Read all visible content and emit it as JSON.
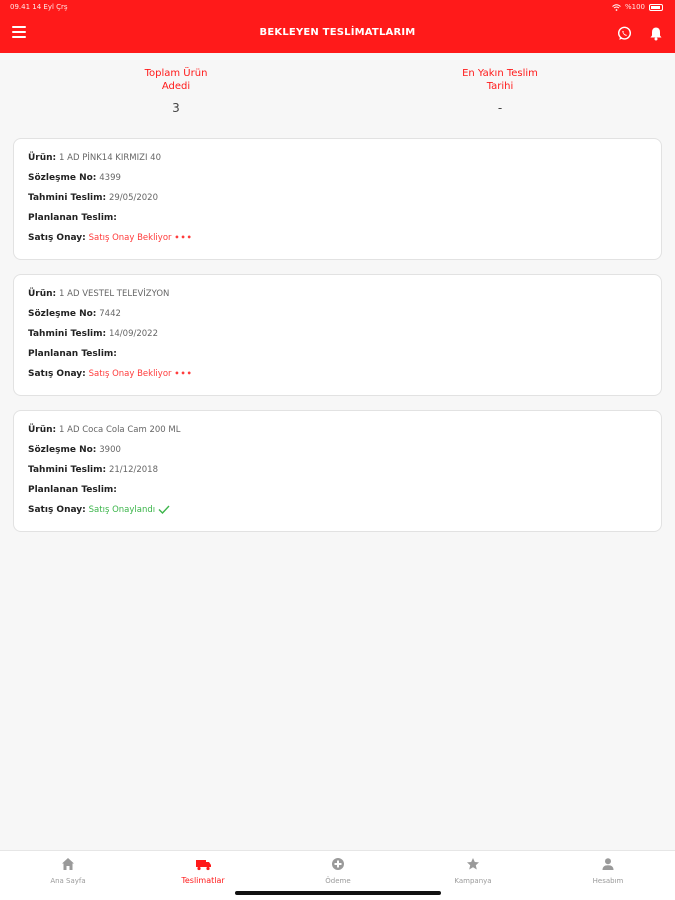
{
  "status_bar": {
    "time": "09.41",
    "date": "14 Eyl Çrş",
    "battery": "%100"
  },
  "header": {
    "title": "BEKLEYEN TESLİMATLARIM"
  },
  "summary": {
    "total_label": "Toplam Ürün\nAdedi",
    "total_value": "3",
    "nearest_label": "En Yakın Teslim\nTarihi",
    "nearest_value": "-"
  },
  "labels": {
    "product": "Ürün:",
    "contract": "Sözleşme No:",
    "estimated": "Tahmini Teslim:",
    "planned": "Planlanan Teslim:",
    "approval": "Satış Onay:"
  },
  "deliveries": [
    {
      "product": "1 AD PİNK14 KIRMIZI 40",
      "contract": "4399",
      "estimated": "29/05/2020",
      "planned": "",
      "approval": "Satış Onay Bekliyor",
      "approval_icon": "dots-icon"
    },
    {
      "product": "1 AD VESTEL TELEVİZYON",
      "contract": "7442",
      "estimated": "14/09/2022",
      "planned": "",
      "approval": "Satış Onay Bekliyor",
      "approval_icon": "dots-icon"
    },
    {
      "product": "1 AD Coca Cola Cam 200 ML",
      "contract": "3900",
      "estimated": "21/12/2018",
      "planned": "",
      "approval": "Satış Onaylandı",
      "approval_icon": "check-icon"
    }
  ],
  "tabs": [
    {
      "label": "Ana Sayfa",
      "icon": "home-icon"
    },
    {
      "label": "Teslimatlar",
      "icon": "truck-icon",
      "active": true
    },
    {
      "label": "Ödeme",
      "icon": "payment-icon"
    },
    {
      "label": "Kampanya",
      "icon": "star-icon"
    },
    {
      "label": "Hesabım",
      "icon": "user-icon"
    }
  ],
  "colors": {
    "brand": "#ff1a1a",
    "pending": "#ff3b3b",
    "approved": "#3bb54a"
  }
}
